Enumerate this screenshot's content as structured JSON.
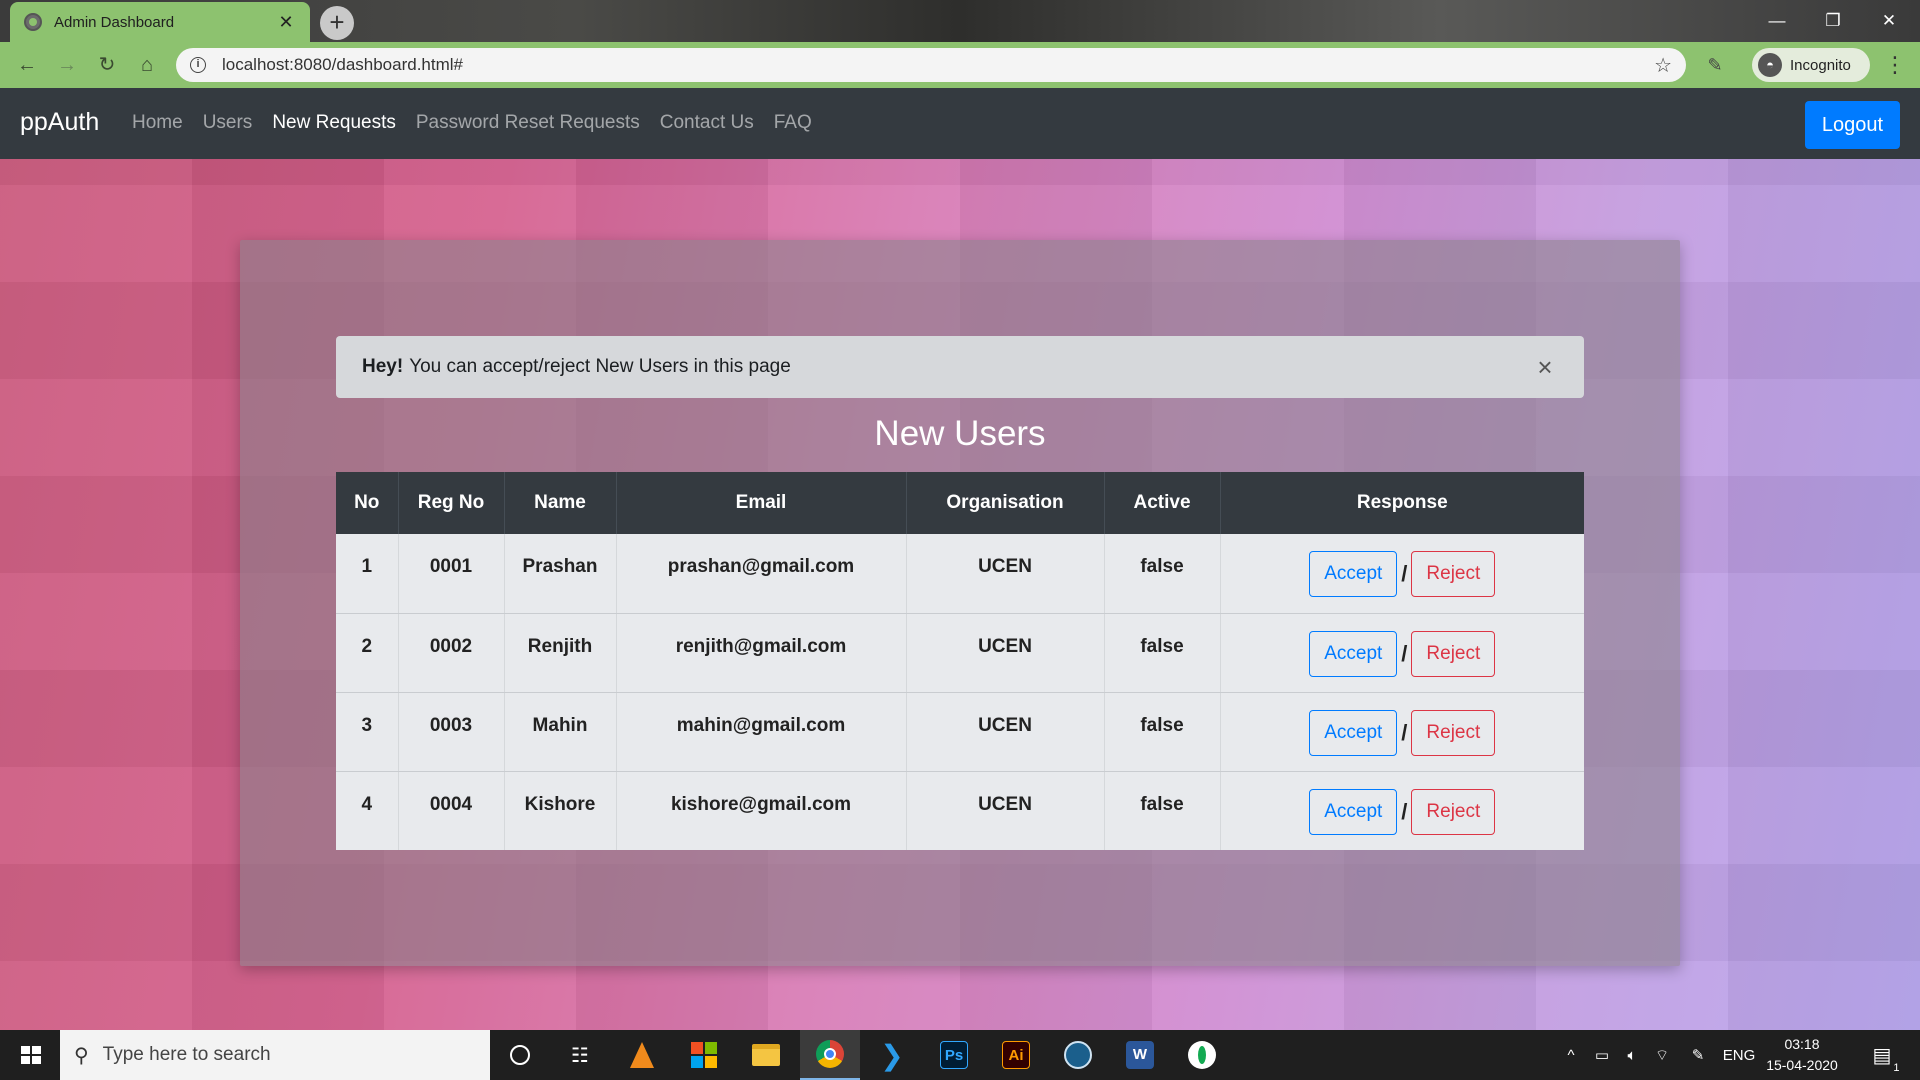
{
  "browser": {
    "tab_title": "Admin Dashboard",
    "url": "localhost:8080/dashboard.html#",
    "incognito_label": "Incognito"
  },
  "navbar": {
    "brand": "ppAuth",
    "links": [
      {
        "label": "Home"
      },
      {
        "label": "Users"
      },
      {
        "label": "New Requests"
      },
      {
        "label": "Password Reset Requests"
      },
      {
        "label": "Contact Us"
      },
      {
        "label": "FAQ"
      }
    ],
    "logout_label": "Logout"
  },
  "alert": {
    "strong": "Hey!",
    "text": "You can accept/reject New Users in this page"
  },
  "section_title": "New Users",
  "table": {
    "headers": [
      "No",
      "Reg No",
      "Name",
      "Email",
      "Organisation",
      "Active",
      "Response"
    ],
    "rows": [
      {
        "no": "1",
        "reg": "0001",
        "name": "Prashan",
        "email": "prashan@gmail.com",
        "org": "UCEN",
        "active": "false"
      },
      {
        "no": "2",
        "reg": "0002",
        "name": "Renjith",
        "email": "renjith@gmail.com",
        "org": "UCEN",
        "active": "false"
      },
      {
        "no": "3",
        "reg": "0003",
        "name": "Mahin",
        "email": "mahin@gmail.com",
        "org": "UCEN",
        "active": "false"
      },
      {
        "no": "4",
        "reg": "0004",
        "name": "Kishore",
        "email": "kishore@gmail.com",
        "org": "UCEN",
        "active": "false"
      }
    ],
    "accept_label": "Accept",
    "reject_label": "Reject",
    "separator": "/"
  },
  "taskbar": {
    "search_placeholder": "Type here to search",
    "language": "ENG",
    "time": "03:18",
    "date": "15-04-2020",
    "notification_count": "1"
  },
  "colors": {
    "navbar_bg": "#343a40",
    "primary": "#007bff",
    "danger": "#dc3545",
    "chrome_green": "#8dc26f"
  }
}
